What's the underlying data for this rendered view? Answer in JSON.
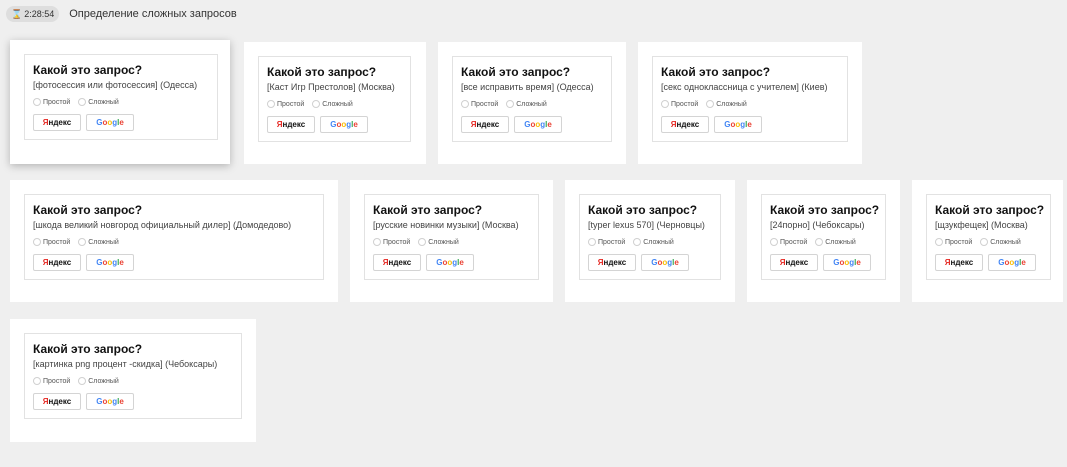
{
  "header": {
    "timer_icon": "hourglass-icon",
    "timer": "2:28:54",
    "title": "Определение сложных запросов"
  },
  "common": {
    "question": "Какой это запрос?",
    "option_simple": "Простой",
    "option_complex": "Сложный",
    "yandex_first": "Я",
    "yandex_rest": "ндекс",
    "google_letters": [
      "G",
      "o",
      "o",
      "g",
      "l",
      "e"
    ]
  },
  "colors": {
    "yandex_red": "#e52620",
    "google_blue": "#4285f4",
    "google_red": "#ea4335",
    "google_yellow": "#fbbc05",
    "google_green": "#34a853"
  },
  "cards": [
    {
      "query": "[фотосессия или фотосессия] (Одесса)",
      "active": true
    },
    {
      "query": "[Каст Игр Престолов] (Москва)"
    },
    {
      "query": "[все исправить время] (Одесса)"
    },
    {
      "query": "[секс одноклассница с учителем] (Киев)"
    },
    {
      "query": "[шкода великий новгород официальный дилер] (Домодедово)"
    },
    {
      "query": "[русские новинки музыки] (Москва)"
    },
    {
      "query": "[typer lexus 570] (Черновцы)"
    },
    {
      "query": "[24порно] (Чебоксары)"
    },
    {
      "query": "[щзукфещек] (Москва)"
    },
    {
      "query": "[картинка png процент -скидка] (Чебоксары)"
    }
  ]
}
